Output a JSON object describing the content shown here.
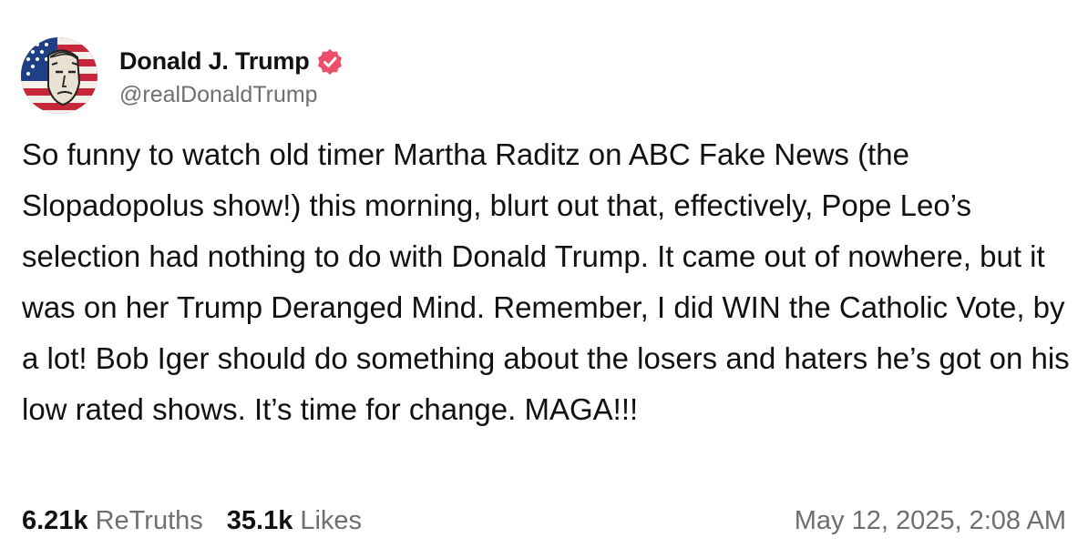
{
  "author": {
    "display_name": "Donald J. Trump",
    "handle": "@realDonaldTrump",
    "verified": true,
    "verified_color": "#ec4e6b",
    "avatar_icon": "flag-portrait-avatar"
  },
  "post": {
    "text": "So funny to watch old timer Martha Raditz on ABC Fake News (the Slopadopolus show!) this morning, blurt out that, effectively, Pope Leo’s selection had nothing to do with Donald Trump. It came out of nowhere, but it was on her Trump Deranged Mind. Remember, I did WIN the Catholic Vote, by a lot! Bob Iger should do something about the losers and haters he’s got on his low rated shows. It’s time for change. MAGA!!!"
  },
  "stats": {
    "retruths_count": "6.21k",
    "retruths_label": "ReTruths",
    "likes_count": "35.1k",
    "likes_label": "Likes"
  },
  "timestamp": "May 12, 2025, 2:08 AM"
}
